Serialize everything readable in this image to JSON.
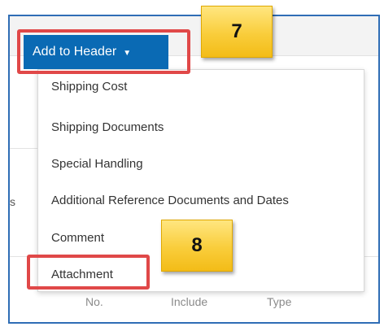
{
  "header_button": {
    "label": "Add to Header",
    "caret": "▼"
  },
  "menu": {
    "items": [
      "Shipping Cost",
      "Shipping Documents",
      "Special Handling",
      "Additional Reference Documents and Dates",
      "Comment",
      "Attachment"
    ]
  },
  "callouts": {
    "step_1": "7",
    "step_2": "8"
  },
  "background": {
    "cut_text": "s",
    "columns": [
      "No.",
      "Include",
      "Type"
    ]
  },
  "colors": {
    "button": "#0a6ab4",
    "highlight": "#e04848",
    "callout": "#f9cd3b",
    "frame": "#2f6db5"
  }
}
